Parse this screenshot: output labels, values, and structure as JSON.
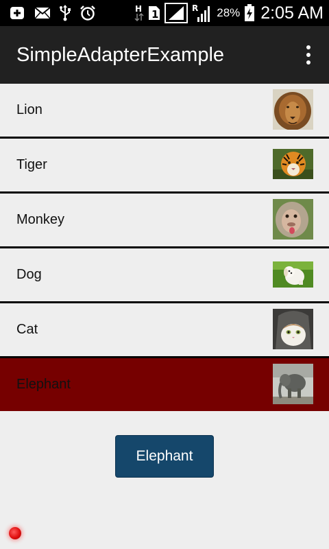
{
  "status_bar": {
    "battery_percent": "28%",
    "time": "2:05 AM",
    "icons": [
      "add-notification-icon",
      "mail-icon",
      "usb-icon",
      "alarm-icon",
      "hspa-data-icon",
      "sim-1-icon",
      "signal-icon",
      "roaming-signal-icon",
      "battery-charging-icon"
    ]
  },
  "action_bar": {
    "title": "SimpleAdapterExample"
  },
  "list": {
    "items": [
      {
        "label": "Lion",
        "icon": "lion-image"
      },
      {
        "label": "Tiger",
        "icon": "tiger-image"
      },
      {
        "label": "Monkey",
        "icon": "monkey-image"
      },
      {
        "label": "Dog",
        "icon": "dog-image"
      },
      {
        "label": "Cat",
        "icon": "cat-image"
      },
      {
        "label": "Elephant",
        "icon": "elephant-image"
      }
    ],
    "selected_index": 5
  },
  "button": {
    "label": "Elephant"
  },
  "colors": {
    "status_bar_bg": "#000000",
    "action_bar_bg": "#212121",
    "list_bg": "#eeeeee",
    "selected_row_bg": "#760000",
    "button_bg": "#15476b"
  }
}
